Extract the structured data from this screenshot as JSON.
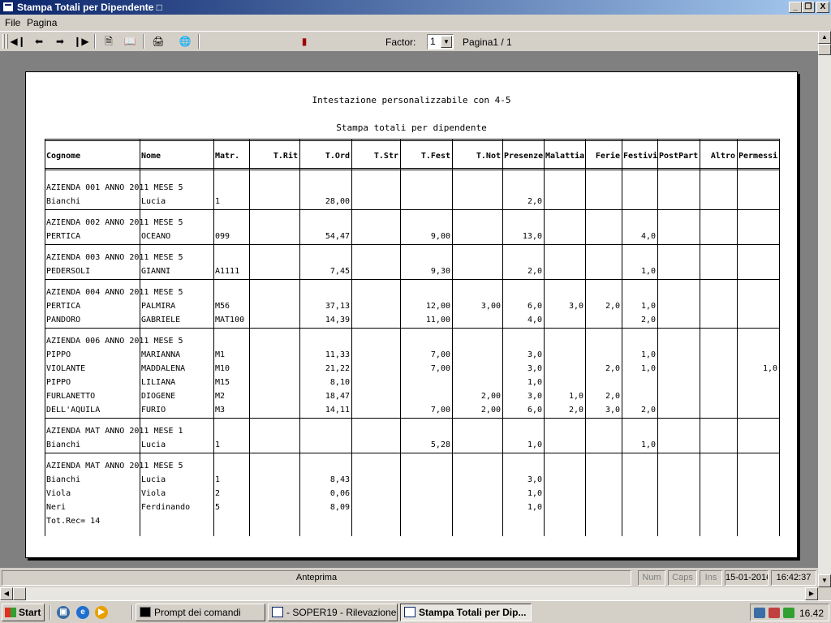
{
  "window": {
    "title": "Stampa Totali per Dipendente □",
    "min_glyph": "_",
    "restore_glyph": "❐",
    "close_glyph": "X"
  },
  "menu": {
    "file": "File",
    "pagina": "Pagina"
  },
  "toolbar": {
    "icons": [
      "first-page-icon",
      "prev-page-icon",
      "next-page-icon",
      "last-page-icon",
      "single-page-icon",
      "two-page-icon",
      "print-icon",
      "export-icon",
      "exit-icon"
    ],
    "factor_label": "Factor:",
    "factor_value": "1",
    "page_label": "Pagina1 / 1"
  },
  "report": {
    "header": "Intestazione personalizzabile con 4-5",
    "subtitle": "Stampa totali per dipendente",
    "columns": [
      "Cognome",
      "Nome",
      "Matr.",
      "T.Rit",
      "T.Ord",
      "T.Str",
      "T.Fest",
      "T.Not",
      "Presenze",
      "Malattia",
      "Ferie",
      "Festivi",
      "PostPart",
      "Altro",
      "Permessi"
    ],
    "groups": [
      {
        "header": "AZIENDA 001 ANNO 2011 MESE  5",
        "rows": [
          [
            "Bianchi",
            "Lucia",
            "1",
            "",
            "28,00",
            "",
            "",
            "",
            "2,0",
            "",
            "",
            "",
            "",
            "",
            ""
          ]
        ]
      },
      {
        "header": "AZIENDA 002 ANNO 2011 MESE  5",
        "rows": [
          [
            "PERTICA",
            "OCEANO",
            "099",
            "",
            "54,47",
            "",
            "9,00",
            "",
            "13,0",
            "",
            "",
            "4,0",
            "",
            "",
            ""
          ]
        ]
      },
      {
        "header": "AZIENDA 003 ANNO 2011 MESE  5",
        "rows": [
          [
            "PEDERSOLI",
            "GIANNI",
            "A1111",
            "",
            "7,45",
            "",
            "9,30",
            "",
            "2,0",
            "",
            "",
            "1,0",
            "",
            "",
            ""
          ]
        ]
      },
      {
        "header": "AZIENDA 004 ANNO 2011 MESE  5",
        "rows": [
          [
            "PERTICA",
            "PALMIRA",
            "M56",
            "",
            "37,13",
            "",
            "12,00",
            "3,00",
            "6,0",
            "3,0",
            "2,0",
            "1,0",
            "",
            "",
            ""
          ],
          [
            "PANDORO",
            "GABRIELE",
            "MAT100",
            "",
            "14,39",
            "",
            "11,00",
            "",
            "4,0",
            "",
            "",
            "2,0",
            "",
            "",
            ""
          ]
        ]
      },
      {
        "header": "AZIENDA 006 ANNO 2011 MESE  5",
        "rows": [
          [
            "PIPPO",
            "MARIANNA",
            "M1",
            "",
            "11,33",
            "",
            "7,00",
            "",
            "3,0",
            "",
            "",
            "1,0",
            "",
            "",
            ""
          ],
          [
            "VIOLANTE",
            "MADDALENA",
            "M10",
            "",
            "21,22",
            "",
            "7,00",
            "",
            "3,0",
            "",
            "2,0",
            "1,0",
            "",
            "",
            "1,0"
          ],
          [
            "PIPPO",
            "LILIANA",
            "M15",
            "",
            "8,10",
            "",
            "",
            "",
            "1,0",
            "",
            "",
            "",
            "",
            "",
            ""
          ],
          [
            "FURLANETTO",
            "DIOGENE",
            "M2",
            "",
            "18,47",
            "",
            "",
            "2,00",
            "3,0",
            "1,0",
            "2,0",
            "",
            "",
            "",
            ""
          ],
          [
            "DELL'AQUILA",
            "FURIO",
            "M3",
            "",
            "14,11",
            "",
            "7,00",
            "2,00",
            "6,0",
            "2,0",
            "3,0",
            "2,0",
            "",
            "",
            ""
          ]
        ]
      },
      {
        "header": "AZIENDA MAT ANNO 2011 MESE  1",
        "rows": [
          [
            "Bianchi",
            "Lucia",
            "1",
            "",
            "",
            "",
            "5,28",
            "",
            "1,0",
            "",
            "",
            "1,0",
            "",
            "",
            ""
          ]
        ]
      },
      {
        "header": "AZIENDA MAT ANNO 2011 MESE  5",
        "rows": [
          [
            "Bianchi",
            "Lucia",
            "1",
            "",
            "8,43",
            "",
            "",
            "",
            "3,0",
            "",
            "",
            "",
            "",
            "",
            ""
          ],
          [
            "Viola",
            "Viola",
            "2",
            "",
            "0,06",
            "",
            "",
            "",
            "1,0",
            "",
            "",
            "",
            "",
            "",
            ""
          ],
          [
            "Neri",
            "Ferdinando",
            "5",
            "",
            "8,09",
            "",
            "",
            "",
            "1,0",
            "",
            "",
            "",
            "",
            "",
            ""
          ]
        ],
        "footer": "Tot.Rec= 14"
      }
    ]
  },
  "statusbar": {
    "mode": "Anteprima",
    "num": "Num",
    "caps": "Caps",
    "ins": "Ins",
    "date": "15-01-2016",
    "time": "16:42:37"
  },
  "taskbar": {
    "start": "Start",
    "quick_icons": [
      "desktop-icon",
      "ie-icon",
      "media-icon"
    ],
    "tasks": [
      {
        "label": "Prompt dei comandi",
        "active": false
      },
      {
        "label": "- SOPER19 - Rilevazione ...",
        "active": false
      },
      {
        "label": "Stampa Totali per Dip...",
        "active": true
      }
    ],
    "clock": "16.42"
  }
}
